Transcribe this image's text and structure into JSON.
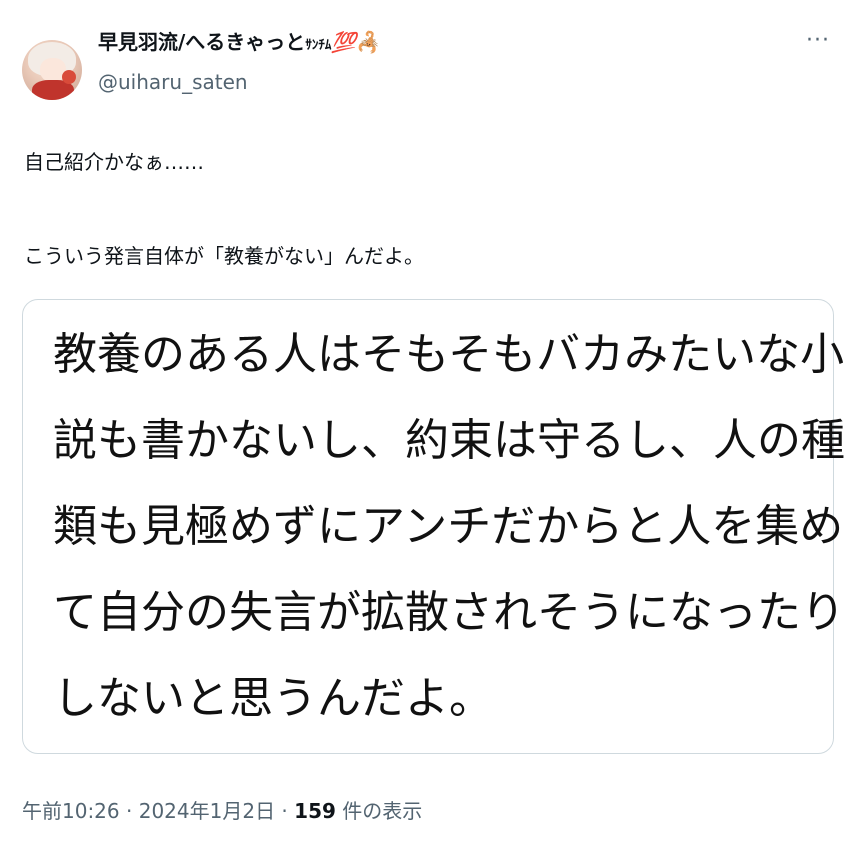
{
  "author": {
    "display_name": "早見羽流/へるきゃっと",
    "name_badge": "ｻﾝﾁﾑ",
    "name_emoji_100": "💯",
    "name_emoji_scorpion": "🦂",
    "handle": "@uiharu_saten"
  },
  "menu": {
    "more_label": "···"
  },
  "tweet": {
    "line1": "自己紹介かなぁ……",
    "line2": "こういう発言自体が「教養がない」んだよ。"
  },
  "quoted_image": {
    "lines": [
      "教養のある人はそもそもバカみたいな小",
      "説も書かないし、約束は守るし、人の種",
      "類も見極めずにアンチだからと人を集め",
      "て自分の失言が拡散されそうになったり",
      "しないと思うんだよ。"
    ]
  },
  "meta": {
    "time": "午前10:26",
    "separator1": " · ",
    "date": "2024年1月2日",
    "separator2": " · ",
    "view_count": "159",
    "view_label": " 件の表示"
  }
}
